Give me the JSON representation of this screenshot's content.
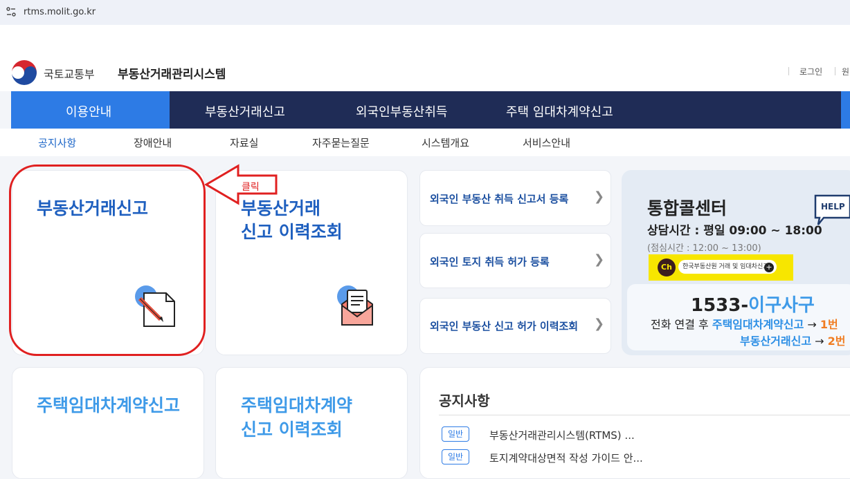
{
  "browser": {
    "url": "rtms.molit.go.kr",
    "site_info_icon": "tune-icon"
  },
  "header": {
    "ministry": "국토교통부",
    "system_title": "부동산거래관리시스템",
    "login": "로그인",
    "more": "원"
  },
  "main_nav": [
    {
      "label": "이용안내",
      "active": true
    },
    {
      "label": "부동산거래신고"
    },
    {
      "label": "외국인부동산취득"
    },
    {
      "label": "주택 임대차계약신고"
    }
  ],
  "sub_nav": [
    {
      "label": "공지사항",
      "active": true
    },
    {
      "label": "장애안내"
    },
    {
      "label": "자료실"
    },
    {
      "label": "자주묻는질문"
    },
    {
      "label": "시스템개요"
    },
    {
      "label": "서비스안내"
    }
  ],
  "cards": {
    "real_estate_report": {
      "title": "부동산거래신고",
      "icon": "document-pen-icon"
    },
    "report_history": {
      "title_line1": "부동산거래",
      "title_line2": "신고 이력조회",
      "icon": "mail-icon"
    },
    "rental_report": {
      "title": "주택임대차계약신고"
    },
    "rental_history": {
      "title_line1": "주택임대차계약",
      "title_line2": "신고 이력조회"
    }
  },
  "foreign_links": [
    {
      "label": "외국인 부동산 취득 신고서 등록"
    },
    {
      "label": "외국인 토지 취득 허가 등록"
    },
    {
      "label": "외국인 부동산 신고 허가 이력조회"
    }
  ],
  "call_center": {
    "title": "통합콜센터",
    "hours": "상담시간 : 평일 09:00 ~ 18:00",
    "break": "(점심시간 : 12:00 ~ 13:00)",
    "help_badge": "HELP",
    "kakao_ch": "Ch",
    "kakao_text": "한국부동산원 거래 및 임대차신고",
    "phone_prefix": "1533-",
    "phone_word": "이구사구",
    "line1_prefix": "전화 연결 후 ",
    "line1_service": "주택임대차계약신고",
    "line1_arrow": " → ",
    "line1_key": "1번",
    "line2_service": "부동산거래신고",
    "line2_arrow": " → ",
    "line2_key": "2번"
  },
  "notice": {
    "title": "공지사항",
    "items": [
      {
        "badge": "일반",
        "text": "부동산거래관리시스템(RTMS) ..."
      },
      {
        "badge": "일반",
        "text": "토지계약대상면적 작성 가이드 안..."
      }
    ]
  },
  "annotation": {
    "click_label": "클릭",
    "color": "#e02020"
  },
  "colors": {
    "nav_bg": "#1f2c56",
    "nav_active": "#2d7be5",
    "card_title": "#1e5fbf",
    "card_title_light": "#3e9ae8"
  }
}
